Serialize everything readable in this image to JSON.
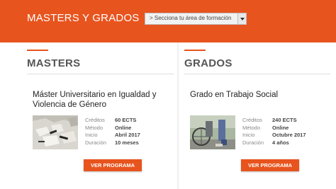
{
  "header": {
    "title": "MASTERS Y GRADOS",
    "select_value": "> Secciona tu área de formación"
  },
  "masters": {
    "heading": "MASTERS",
    "program_title": "Máster Universitario en Igualdad y Violencia de Género",
    "details": [
      {
        "label": "Créditos",
        "value": "60 ECTS"
      },
      {
        "label": "Método",
        "value": "Online"
      },
      {
        "label": "Inicio",
        "value": "Abril 2017"
      },
      {
        "label": "Duración",
        "value": "10 meses"
      }
    ],
    "button": "VER PROGRAMA"
  },
  "grados": {
    "heading": "GRADOS",
    "program_title": "Grado en Trabajo Social",
    "details": [
      {
        "label": "Créditos",
        "value": "240 ECTS"
      },
      {
        "label": "Método",
        "value": "Online"
      },
      {
        "label": "Inicio",
        "value": "Octubre 2017"
      },
      {
        "label": "Duración",
        "value": "4 años"
      }
    ],
    "button": "VER PROGRAMA"
  },
  "colors": {
    "accent": "#e8541e",
    "background": "#efefef"
  },
  "icons": {
    "select_arrow": "chevron-down-icon"
  }
}
